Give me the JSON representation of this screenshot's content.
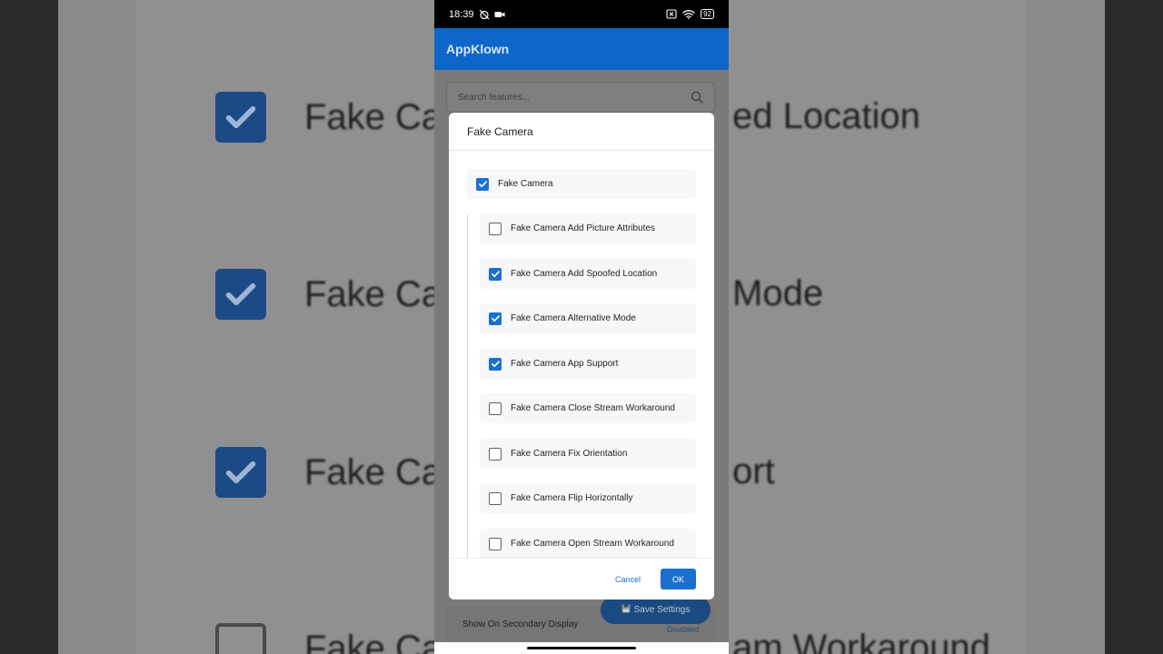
{
  "background": {
    "rows": [
      {
        "label": "Fake Ca",
        "right": "ed Location",
        "checked": true
      },
      {
        "label": "Fake Ca",
        "right": "Mode",
        "checked": true
      },
      {
        "label": "Fake Ca",
        "right": "ort",
        "checked": true
      },
      {
        "label": "Fake Ca",
        "right": "am Workaround",
        "checked": false
      }
    ]
  },
  "statusbar": {
    "time": "18:39",
    "battery": "92"
  },
  "app": {
    "title": "AppKlown",
    "search_placeholder": "Search features...",
    "bottom_row_label": "Show On Secondary Display",
    "bottom_row_status": "Disabled",
    "save_button": "Save Settings"
  },
  "dialog": {
    "title": "Fake Camera",
    "master": {
      "label": "Fake Camera",
      "checked": true
    },
    "items": [
      {
        "label": "Fake Camera Add Picture Attributes",
        "checked": false
      },
      {
        "label": "Fake Camera Add Spoofed Location",
        "checked": true
      },
      {
        "label": "Fake Camera Alternative Mode",
        "checked": true
      },
      {
        "label": "Fake Camera App Support",
        "checked": true
      },
      {
        "label": "Fake Camera Close Stream Workaround",
        "checked": false
      },
      {
        "label": "Fake Camera Fix Orientation",
        "checked": false
      },
      {
        "label": "Fake Camera Flip Horizontally",
        "checked": false
      },
      {
        "label": "Fake Camera Open Stream Workaround",
        "checked": false
      }
    ],
    "cancel_label": "Cancel",
    "ok_label": "OK"
  },
  "colors": {
    "accent": "#1b6fd1",
    "appbar": "#0f66c9"
  },
  "icons": {
    "search": "search-icon",
    "save": "floppy-disk-icon",
    "check": "checkmark-icon"
  }
}
